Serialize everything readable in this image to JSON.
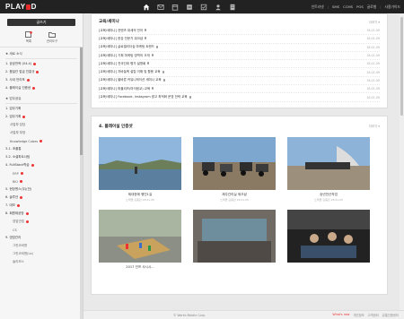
{
  "app": {
    "logo_pre": "PLAY",
    "logo_post": "D"
  },
  "top_links": [
    "인트라넷",
    "SMS",
    "CCMS",
    "POS",
    "글로벌",
    "사용가이드"
  ],
  "top_icons": [
    "home-icon",
    "mail-icon",
    "calendar-icon",
    "board-icon",
    "approval-icon",
    "person-icon",
    "document-icon"
  ],
  "sidebar": {
    "write_label": "글쓰기",
    "icon_buttons": [
      {
        "label": "목록"
      },
      {
        "label": "관리도구"
      }
    ],
    "section1_head": "★ 세로 소식",
    "section1_items": [
      {
        "label": "1. 공공전략 (V4.4)",
        "dot": true
      },
      {
        "label": "2. 품질관 업급 진흥규",
        "dot": true
      },
      {
        "label": "3. 사내 언리포",
        "dot": true
      },
      {
        "label": "4. 플레이실 인증센",
        "dot": true
      }
    ],
    "section2_head": "★ 업무공유",
    "section2_items": [
      {
        "label": "1. 업무기획",
        "dot": false,
        "level": 0
      },
      {
        "label": "2. 업무기획",
        "dot": true,
        "level": 0
      },
      {
        "label": "사업부 담당",
        "dot": false,
        "level": 1
      },
      {
        "label": "사업부 부장",
        "dot": false,
        "level": 1
      },
      {
        "label": "Knowledge Cubes",
        "dot": true,
        "level": 1
      },
      {
        "label": "3-1. 조플통",
        "dot": false,
        "level": 0
      },
      {
        "label": "3-2. 소셜파트너팀",
        "dot": false,
        "level": 0
      },
      {
        "label": "4. FullStack학습",
        "dot": true,
        "level": 0
      },
      {
        "label": "ERP",
        "dot": true,
        "level": 2
      },
      {
        "label": "BKI",
        "dot": true,
        "level": 2
      },
      {
        "label": "5. 현장엔스(우)(전)",
        "dot": false,
        "level": 0
      },
      {
        "label": "6. 솔루션",
        "dot": true,
        "level": 0
      },
      {
        "label": "7. 데모",
        "dot": true,
        "level": 0
      },
      {
        "label": "8. 회원제공방",
        "dot": true,
        "level": 0
      },
      {
        "label": "영업관법",
        "dot": true,
        "level": 2
      },
      {
        "label": "CS",
        "dot": false,
        "level": 2
      },
      {
        "label": "9. 영업관리",
        "dot": false,
        "level": 0
      },
      {
        "label": "그린코비엔",
        "dot": false,
        "level": 2
      },
      {
        "label": "그린코비엔(La)",
        "dot": false,
        "level": 2
      },
      {
        "label": "솔리모스",
        "dot": false,
        "level": 2
      }
    ]
  },
  "main": {
    "seminar": {
      "title": "교육/세미나",
      "more": "더보기 ▾",
      "posts": [
        {
          "title": "[교육/세미나] 컨텐츠 대세의 언어",
          "date": "18.01.09"
        },
        {
          "title": "[교육/세미나] 한강 전문가 워크샵",
          "date": "18.01.09"
        },
        {
          "title": "[교육/세미나] 글로벌리더십 마케팅 트렌드",
          "date": "18.01.09"
        },
        {
          "title": "[교육/세미나] 기획 마케팅 영역의 크게",
          "date": "18.01.09"
        },
        {
          "title": "[교육/세미나] 전국단위 평가 설명회",
          "date": "18.01.09"
        },
        {
          "title": "[교육/세미나] 자바놀엑 설립 이해 및 활용 교육",
          "date": "18.01.09"
        },
        {
          "title": "[교육/세미나] 올바른 커뮤니케이션 세미나 교육",
          "date": "18.01.09"
        },
        {
          "title": "[교육/세미나] 퍼블리즈(마이링교) 교육",
          "date": "18.01.09"
        },
        {
          "title": "[교육/세미나] Facebook, Instagram 광고 최적화 운영 전략 교육",
          "date": "18.01.09"
        }
      ]
    },
    "certify": {
      "title": "4. 플레이실 인증샷",
      "more": "더보기 ▾",
      "cards": [
        {
          "caption": "제대한에 행진1길",
          "meta": "노래클 김종민   18.01.05"
        },
        {
          "caption": "제주관리실 워크샵",
          "meta": "노래클 김종민   18.01.05"
        },
        {
          "caption": "송년전산작업",
          "meta": "노래클 김종민   18.01.05"
        },
        {
          "caption": "2017 인프 사시시...",
          "meta": ""
        },
        {
          "caption": "",
          "meta": ""
        },
        {
          "caption": "",
          "meta": ""
        }
      ]
    }
  },
  "footer": {
    "copyright": "© Works Mobile Corp.",
    "links": [
      "What's new",
      "개인정보",
      "고객센터",
      "유통인증센터"
    ]
  }
}
